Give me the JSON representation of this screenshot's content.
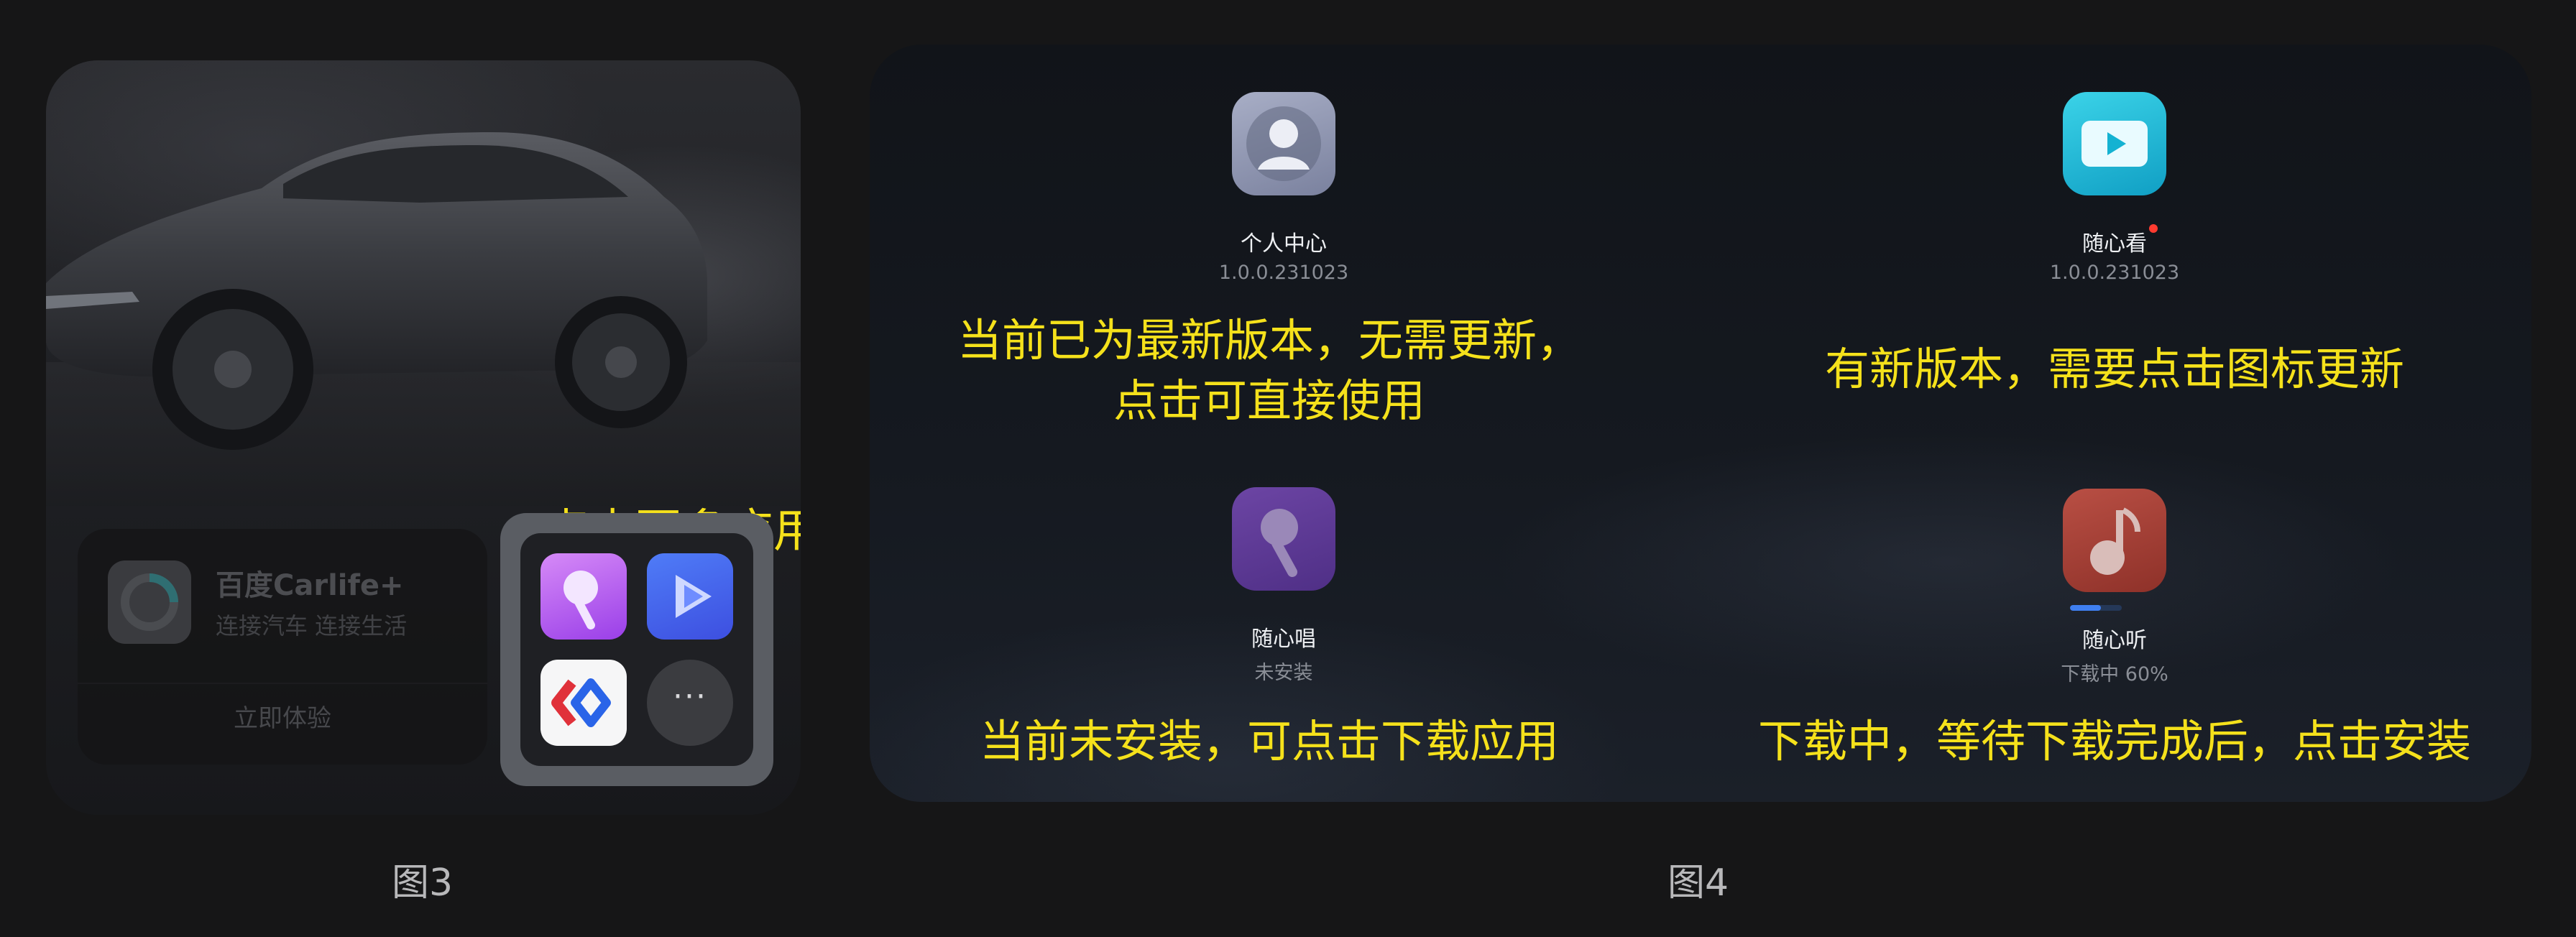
{
  "figure3": {
    "label": "图3",
    "caption": "点击更多应用",
    "carlife_card": {
      "title": "百度Carlife+",
      "subtitle": "连接汽车 连接生活",
      "cta": "立即体验"
    },
    "more_apps": {
      "apps": [
        {
          "icon": "microphone-icon",
          "color": "#b25ef0"
        },
        {
          "icon": "play-icon",
          "color": "#4563ee"
        },
        {
          "icon": "carlife-logo-icon",
          "color": "#f6f6f7"
        }
      ],
      "more_glyph": "···"
    }
  },
  "figure4": {
    "label": "图4",
    "apps": {
      "personal": {
        "name": "个人中心",
        "version": "1.0.0.231023",
        "icon": "person-icon"
      },
      "watch": {
        "name": "随心看",
        "version": "1.0.0.231023",
        "icon": "video-play-icon",
        "has_update": true
      },
      "sing": {
        "name": "随心唱",
        "status": "未安装",
        "icon": "microphone-icon"
      },
      "listen": {
        "name": "随心听",
        "status": "下载中 60%",
        "icon": "music-note-icon",
        "progress": 0.6
      }
    },
    "notes": {
      "latest_line1": "当前已为最新版本，无需更新，",
      "latest_line2": "点击可直接使用",
      "update": "有新版本，需要点击图标更新",
      "install": "当前未安装，可点击下载应用",
      "downloading": "下载中，等待下载完成后，点击安装"
    }
  },
  "colors": {
    "background": "#161617",
    "caption_yellow": "#f5e11b",
    "update_dot": "#ff3b30",
    "progress_blue": "#3f7ff0"
  }
}
